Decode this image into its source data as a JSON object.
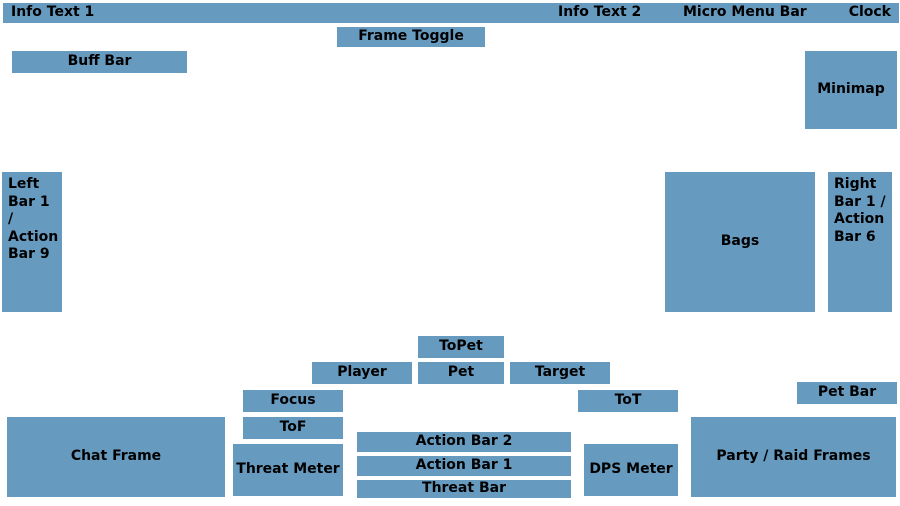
{
  "top": {
    "info1": "Info Text 1",
    "info2": "Info Text 2",
    "micro": "Micro Menu Bar",
    "clock": "Clock",
    "frame_toggle": "Frame Toggle"
  },
  "buff_bar": "Buff Bar",
  "minimap": "Minimap",
  "left_bar": "Left Bar 1 / Action Bar 9",
  "right_bar": "Right Bar 1 / Action Bar 6",
  "bags": "Bags",
  "topet": "ToPet",
  "player": "Player",
  "pet": "Pet",
  "target": "Target",
  "focus": "Focus",
  "tot": "ToT",
  "tof": "ToF",
  "pet_bar": "Pet Bar",
  "chat": "Chat Frame",
  "threat_meter": "Threat Meter",
  "action_bar2": "Action Bar 2",
  "action_bar1": "Action Bar 1",
  "threat_bar": "Threat Bar",
  "dps_meter": "DPS Meter",
  "party": "Party / Raid Frames"
}
